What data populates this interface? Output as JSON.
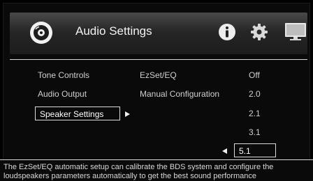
{
  "header": {
    "title": "Audio Settings",
    "icons": [
      "disc-icon",
      "info-icon",
      "gear-icon",
      "tv-icon"
    ]
  },
  "left_menu": {
    "items": [
      {
        "label": "Tone Controls"
      },
      {
        "label": "Audio Output"
      },
      {
        "label": "Speaker Settings",
        "selected": true
      }
    ]
  },
  "middle_menu": {
    "items": [
      {
        "label": "EzSet/EQ"
      },
      {
        "label": "Manual Configuration"
      }
    ]
  },
  "values_list": {
    "items": [
      {
        "label": "Off"
      },
      {
        "label": "2.0"
      },
      {
        "label": "2.1"
      },
      {
        "label": "3.1"
      },
      {
        "label": "5.1",
        "selected": true
      }
    ]
  },
  "footer": {
    "help_text": "The EzSet/EQ automatic setup can calibrate the BDS system and configure the loudspeakers parameters automatically to get the best sound performance"
  },
  "colors": {
    "background": "#000000",
    "text": "#cfcfcf",
    "selection_border": "#dcdcdc"
  }
}
